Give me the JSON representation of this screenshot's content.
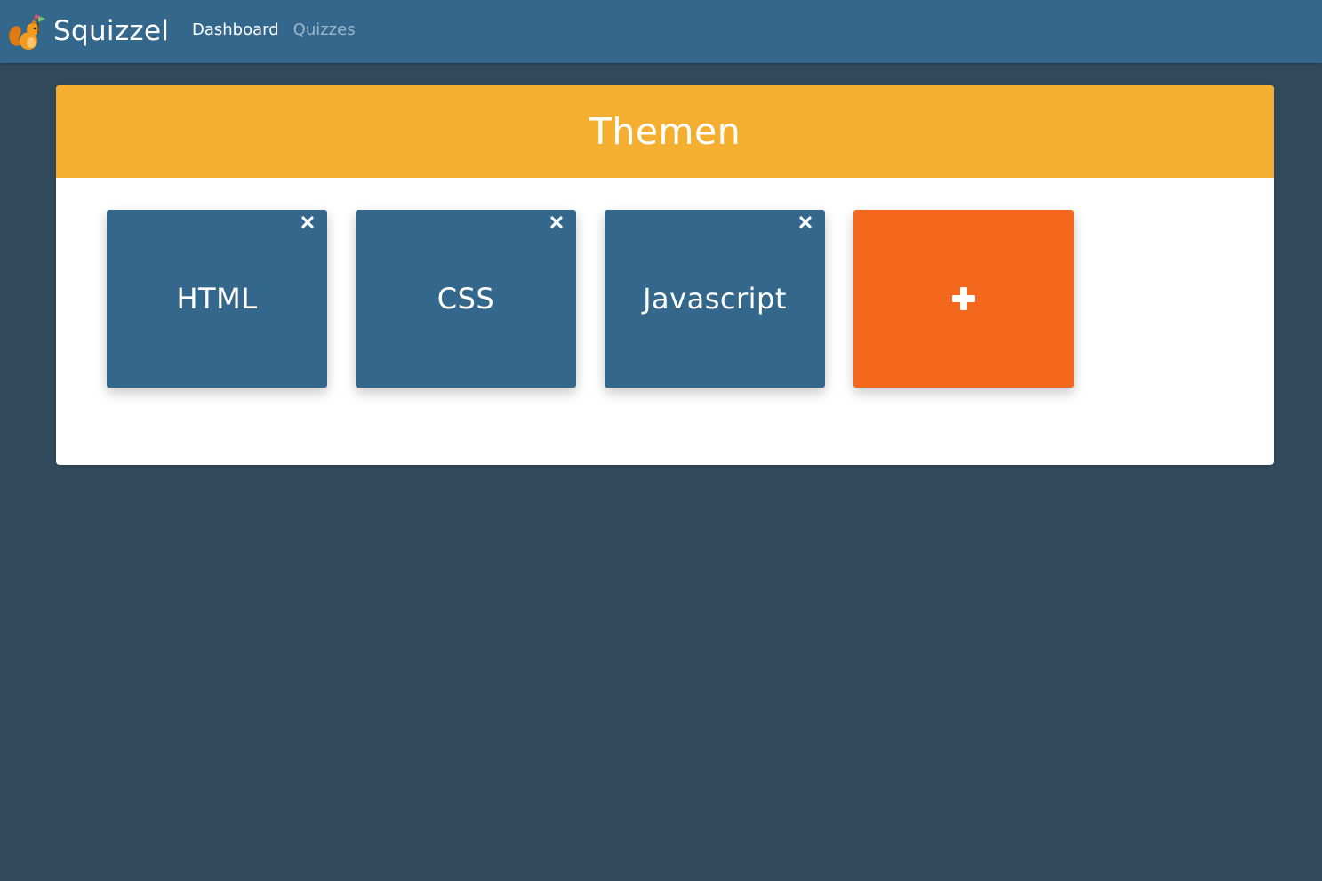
{
  "app": {
    "name": "Squizzel",
    "logo_icon": "squirrel-logo-icon"
  },
  "nav": {
    "items": [
      {
        "label": "Dashboard",
        "active": true
      },
      {
        "label": "Quizzes",
        "active": false
      }
    ]
  },
  "main": {
    "title": "Themen",
    "topics": [
      {
        "label": "HTML",
        "close_icon": "close-icon"
      },
      {
        "label": "CSS",
        "close_icon": "close-icon"
      },
      {
        "label": "Javascript",
        "close_icon": "close-icon"
      }
    ],
    "add_tile": {
      "icon": "plus-icon"
    }
  },
  "colors": {
    "page_background": "#314a5b",
    "navbar": "#34678c",
    "header_accent": "#f4ae30",
    "topic_tile": "#34678c",
    "add_tile": "#f2671c",
    "nav_inactive": "#9db5c9"
  }
}
